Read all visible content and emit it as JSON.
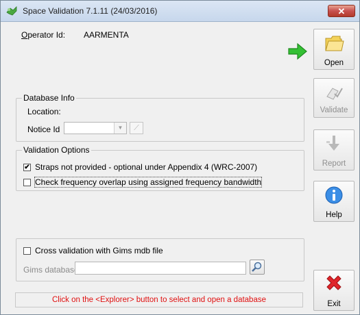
{
  "window": {
    "title": "Space Validation 7.1.11 (24/03/2016)",
    "close_label": "✕"
  },
  "operator": {
    "label": "Operator Id:",
    "value": "AARMENTA"
  },
  "buttons": {
    "open": {
      "label": "Open",
      "enabled": true
    },
    "validate": {
      "label": "Validate",
      "enabled": false
    },
    "report": {
      "label": "Report",
      "enabled": false
    },
    "help": {
      "label": "Help",
      "enabled": true
    },
    "exit": {
      "label": "Exit",
      "enabled": true
    }
  },
  "database_info": {
    "title": "Database Info",
    "location_label": "Location:",
    "notice_label": "Notice Id",
    "notice_value": ""
  },
  "validation_options": {
    "title": "Validation Options",
    "options": [
      {
        "label": "Straps not provided - optional under Appendix 4 (WRC-2007)",
        "checked": true
      },
      {
        "label": "Check frequency overlap using assigned frequency bandwidth",
        "checked": false
      }
    ]
  },
  "cross_validation": {
    "checkbox_label": "Cross validation with Gims mdb file",
    "checked": false,
    "gims_label": "Gims database:",
    "gims_value": ""
  },
  "status": {
    "message": "Click on the <Explorer> button to select and open a database"
  },
  "colors": {
    "status_text": "#e01010",
    "arrow": "#2fb52f",
    "exit_x": "#e0262b",
    "help_icon": "#2a7ad8"
  }
}
